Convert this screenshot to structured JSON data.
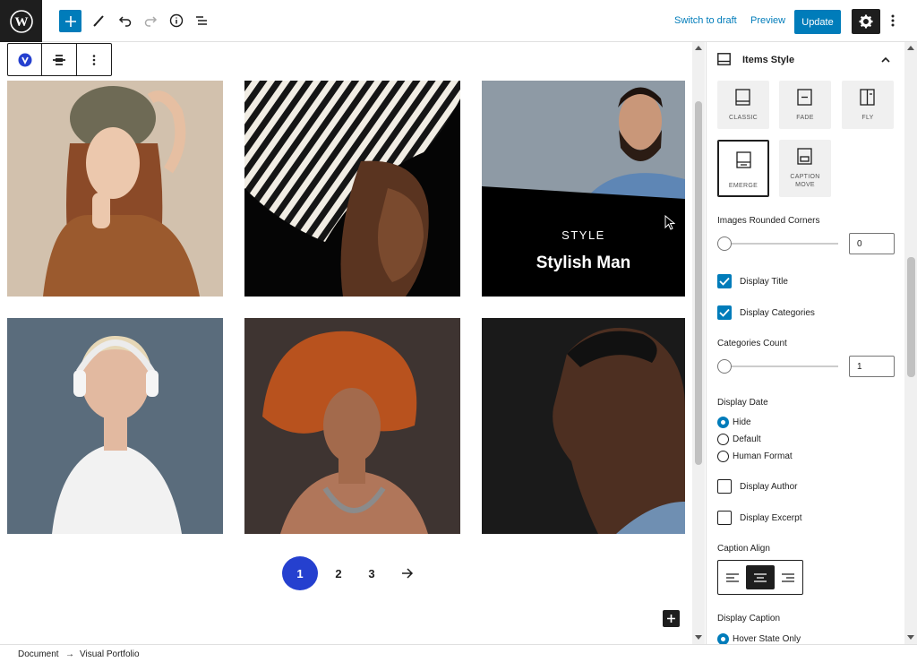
{
  "topbar": {
    "switch_draft": "Switch to draft",
    "preview": "Preview",
    "update": "Update"
  },
  "portfolio": {
    "hover_caption": {
      "category": "STYLE",
      "title": "Stylish Man"
    },
    "pagination": [
      "1",
      "2",
      "3"
    ],
    "current_page": "1"
  },
  "sidebar": {
    "panel_title": "Items Style",
    "styles": [
      {
        "label": "CLASSIC"
      },
      {
        "label": "FADE"
      },
      {
        "label": "FLY"
      },
      {
        "label": "EMERGE",
        "selected": true
      },
      {
        "label_line1": "CAPTION",
        "label_line2": "MOVE"
      }
    ],
    "rounded_corners": {
      "label": "Images Rounded Corners",
      "value": "0"
    },
    "display_title": {
      "label": "Display Title",
      "checked": true
    },
    "display_categories": {
      "label": "Display Categories",
      "checked": true
    },
    "categories_count": {
      "label": "Categories Count",
      "value": "1"
    },
    "display_date": {
      "label": "Display Date",
      "options": [
        "Hide",
        "Default",
        "Human Format"
      ],
      "selected": "Hide"
    },
    "display_author": {
      "label": "Display Author",
      "checked": false
    },
    "display_excerpt": {
      "label": "Display Excerpt",
      "checked": false
    },
    "caption_align": {
      "label": "Caption Align",
      "selected": "center"
    },
    "display_caption": {
      "label": "Display Caption",
      "value": "Hover State Only"
    }
  },
  "breadcrumb": {
    "root": "Document",
    "separator": "→",
    "current": "Visual Portfolio"
  },
  "colors": {
    "accent": "#007cba",
    "pagination_active": "#2540cf",
    "dark": "#1e1e1e"
  }
}
